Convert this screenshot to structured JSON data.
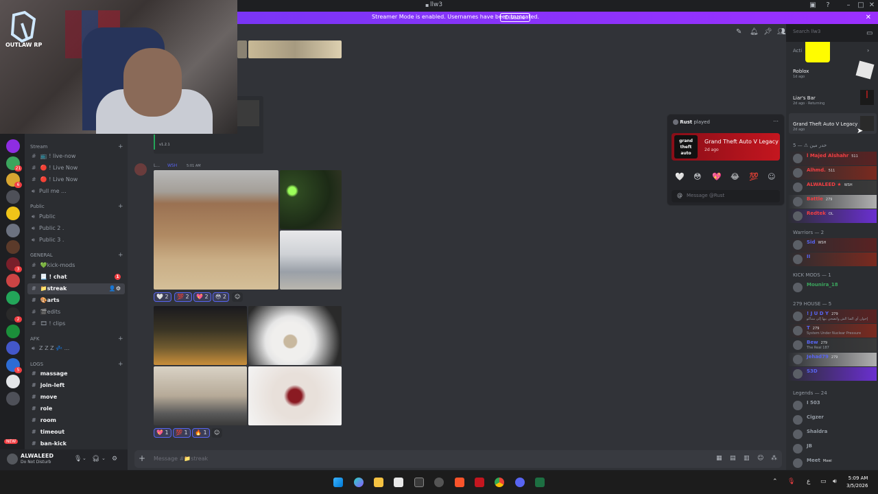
{
  "window": {
    "title": "llw3"
  },
  "banner": {
    "text": "Streamer Mode is enabled. Usernames have been truncated.",
    "button": "Disable"
  },
  "overlay": {
    "logo_text": "OUTLAW RP",
    "version": "v1.2.1"
  },
  "servers": [
    {
      "color": "#8e2de2",
      "badge": ""
    },
    {
      "color": "#3ba55d",
      "badge": "21"
    },
    {
      "color": "#d8a531",
      "badge": "6"
    },
    {
      "color": "#4e5058",
      "badge": ""
    },
    {
      "color": "#f0c419",
      "badge": ""
    },
    {
      "color": "#6c7280",
      "badge": ""
    },
    {
      "color": "#5b3a2a",
      "badge": ""
    },
    {
      "color": "#7a1f2a",
      "badge": "3"
    },
    {
      "color": "#c44",
      "badge": ""
    },
    {
      "color": "#23a559",
      "badge": ""
    },
    {
      "color": "#2a2a2a",
      "badge": "2"
    },
    {
      "color": "#1b8f3a",
      "badge": ""
    },
    {
      "color": "#4357c9",
      "badge": ""
    },
    {
      "color": "#2d6cd4",
      "badge": "5"
    },
    {
      "color": "#e3e5e8",
      "badge": ""
    },
    {
      "color": "#4e5058",
      "badge": ""
    }
  ],
  "channels": {
    "stream_cat": "Stream",
    "stream": [
      "live-now",
      "Live Now",
      "Live Now",
      "Pull me ..."
    ],
    "public_cat": "Public",
    "public": [
      "Public",
      "Public 2 .",
      "Public 3 ."
    ],
    "general_cat": "GENERAL",
    "general": [
      "kick-mods",
      "chat",
      "streak",
      "arts",
      "edits",
      "clips"
    ],
    "chat_badge": "1",
    "afk_cat": "AFK",
    "afk": [
      "Z Z Z"
    ],
    "logs_cat": "LOGS",
    "logs": [
      "massage",
      "join-left",
      "move",
      "role",
      "room",
      "timeout",
      "ban-kick"
    ],
    "new_badge": "NEW"
  },
  "user": {
    "name": "ALWALEED",
    "status": "Do Not Disturb"
  },
  "message": {
    "badge": "WSH",
    "time": "5:01 AM",
    "reactions1": [
      "2",
      "2",
      "2",
      "2"
    ],
    "reactions2": [
      "1",
      "1",
      "1"
    ]
  },
  "composer": {
    "placeholder": "Message #📁streak"
  },
  "popup": {
    "header_name": "Rust",
    "header_suffix": "played",
    "game": "Grand Theft Auto V Legacy",
    "time": "2d ago",
    "logo": "grand theft auto",
    "input_placeholder": "Message @Rust",
    "emojis": [
      "🤍",
      "😳",
      "💖",
      "😂",
      "💯",
      "☺"
    ]
  },
  "members": {
    "search": "Search llw3",
    "activity_cat": "Acti",
    "activities": [
      {
        "game": "Roblox",
        "time": "1d ago"
      },
      {
        "game": "Liar's Bar",
        "time": "2d ago · Returning"
      },
      {
        "game": "Grand Theft Auto V Legacy",
        "time": "2d ago"
      }
    ],
    "cat1": "5 — ⚠ خدر مين",
    "group1": [
      {
        "name": "l Majed Alshahr",
        "tag": "511",
        "color": "#f23f43"
      },
      {
        "name": "Alhmd.",
        "tag": "511",
        "color": "#f23f43"
      },
      {
        "name": "ALWALEED ★",
        "tag": "WSH",
        "color": "#f23f43"
      },
      {
        "name": "Battle",
        "tag": "279",
        "color": "#f23f43"
      },
      {
        "name": "Redtek",
        "tag": "OL",
        "color": "#f23f43"
      }
    ],
    "cat2": "Warriors — 2",
    "group2": [
      {
        "name": "Sid",
        "tag": "WSH",
        "color": "#5865f2"
      },
      {
        "name": "II",
        "tag": "",
        "color": "#5865f2"
      }
    ],
    "cat3": "KICK MODS — 1",
    "group3": [
      {
        "name": "Mounira_18",
        "tag": "",
        "color": "#3ba55d"
      }
    ],
    "cat4": "279 HOUSE — 5",
    "group4": [
      {
        "name": "! J U D Y",
        "tag": "279",
        "color": "#5865f2",
        "sub": "إخوان أي الفنا الش واتضحي بيها إلى منتاكو"
      },
      {
        "name": "T",
        "tag": "279",
        "color": "#5865f2",
        "sub": "System Under Nuclear Pressure"
      },
      {
        "name": "Bew",
        "tag": "279",
        "color": "#5865f2",
        "sub": "The Real 187"
      },
      {
        "name": "Jehad79",
        "tag": "279",
        "color": "#5865f2",
        "sub": ""
      },
      {
        "name": "S3D",
        "tag": "",
        "color": "#5865f2",
        "sub": ""
      }
    ],
    "cat5": "Legends — 24",
    "group5": [
      {
        "name": "I 503",
        "tag": "",
        "color": "#949ba4"
      },
      {
        "name": "Cigzer",
        "tag": "",
        "color": "#949ba4"
      },
      {
        "name": "Shaldra",
        "tag": "",
        "color": "#949ba4"
      },
      {
        "name": "JB",
        "tag": "",
        "color": "#949ba4"
      },
      {
        "name": "Meet",
        "tag": "Mawi",
        "color": "#949ba4"
      }
    ]
  },
  "taskbar": {
    "time": "5:09 AM",
    "date": "3/5/2026",
    "lang": "ع"
  }
}
